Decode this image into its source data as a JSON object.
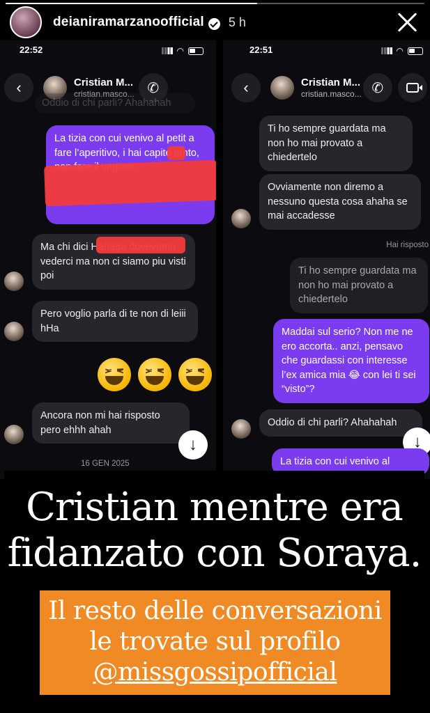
{
  "story": {
    "username": "deianiramarzanoofficial",
    "time_ago": "5 h"
  },
  "left_chat": {
    "clock": "22:52",
    "contact_name": "Cristian M...",
    "contact_handle": "cristian.masco...",
    "back_glyph": "‹",
    "phone_glyph": "✆",
    "top_faded": "Oddio di chi parli? Ahahahah",
    "msg1": "La tizia con cui venivo al petit a fare l’aperitivo, i hai capito tanto, non fare il vagooo",
    "msg2": "Ma chi dici Hahaga dovevamo vederci ma non ci siamo piu visti poi",
    "msg3": "Pero voglio parla di te non di leiii hHa",
    "msg4": "Ancora non mi hai risposto pero ehhh ahah",
    "date": "16 GEN 2025",
    "scroll_glyph": "↓"
  },
  "right_chat": {
    "clock": "22:51",
    "contact_name": "Cristian M...",
    "contact_handle": "cristian.masco...",
    "back_glyph": "‹",
    "phone_glyph": "✆",
    "msg1": "Ti ho sempre guardata ma non ho mai provato a chiedertelo",
    "msg2": "Ovviamente non diremo a nessuno questa cosa ahaha se mai accadesse",
    "replied_label": "Hai risposto",
    "quoted": "Ti ho sempre guardata ma non ho mai provato a chiedertelo",
    "msg3": "Maddai sul serio? Non me ne ero accorta.. anzi, pensavo che guardassi con interesse l’ex amica mia 😂 con lei ti sei “visto”?",
    "msg4": "Oddio di chi parli? Ahahahah",
    "msg5": "La tizia con cui venivo al",
    "scroll_glyph": "↓"
  },
  "overlay": {
    "title_line1": "Cristian mentre era",
    "title_line2": "fidanzato con Soraya.",
    "promo_line1": "Il resto delle conversazioni",
    "promo_line2": "le trovate sul profilo",
    "promo_handle": "@missgossipofficial"
  },
  "colors": {
    "outgoing_bubble": "#7b3cf0",
    "incoming_bubble": "#26262c",
    "promo_bg": "#f08a24",
    "redaction": "#f23b3b"
  }
}
